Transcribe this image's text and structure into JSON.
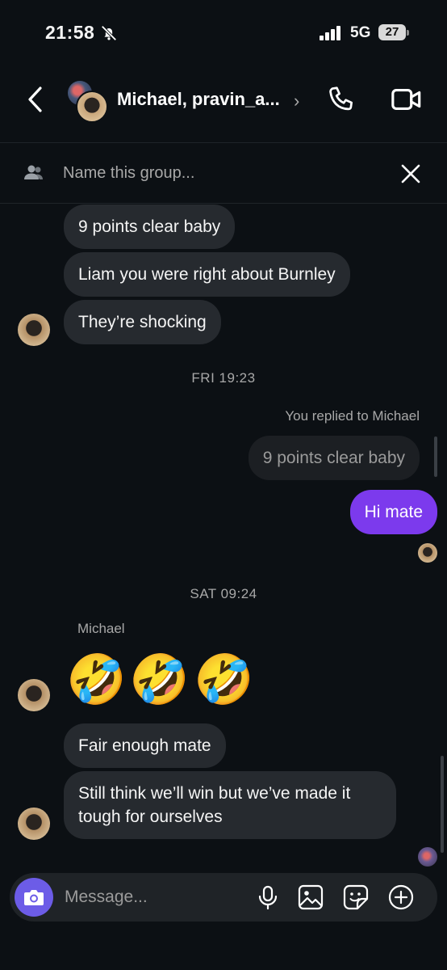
{
  "status_bar": {
    "time": "21:58",
    "network": "5G",
    "battery": "27"
  },
  "header": {
    "title": "Michael, pravin_a..."
  },
  "group_bar": {
    "placeholder": "Name this group..."
  },
  "messages": [
    {
      "text": "9 points clear baby"
    },
    {
      "text": "Liam you were right about Burnley"
    },
    {
      "text": "They’re shocking"
    },
    {
      "timestamp": "FRI 19:23"
    },
    {
      "meta": "You replied to Michael"
    },
    {
      "quoted": "9 points clear baby"
    },
    {
      "text": "Hi mate"
    },
    {
      "timestamp": "SAT 09:24"
    },
    {
      "sender": "Michael"
    },
    {
      "emoji": [
        "🤣",
        "🤣",
        "🤣"
      ]
    },
    {
      "text": "Fair enough mate"
    },
    {
      "text": "Still think we’ll win but we’ve made it tough for ourselves"
    }
  ],
  "composer": {
    "placeholder": "Message..."
  },
  "colors": {
    "background": "#0c1014",
    "bubble": "#262a2f",
    "my_bubble": "#7c3aed",
    "camera_button": "#6c5ce7"
  },
  "icons": [
    "bell-slash-icon",
    "back-chevron-icon",
    "phone-icon",
    "video-icon",
    "people-icon",
    "close-icon",
    "camera-icon",
    "microphone-icon",
    "gallery-icon",
    "sticker-icon",
    "plus-circle-icon"
  ]
}
